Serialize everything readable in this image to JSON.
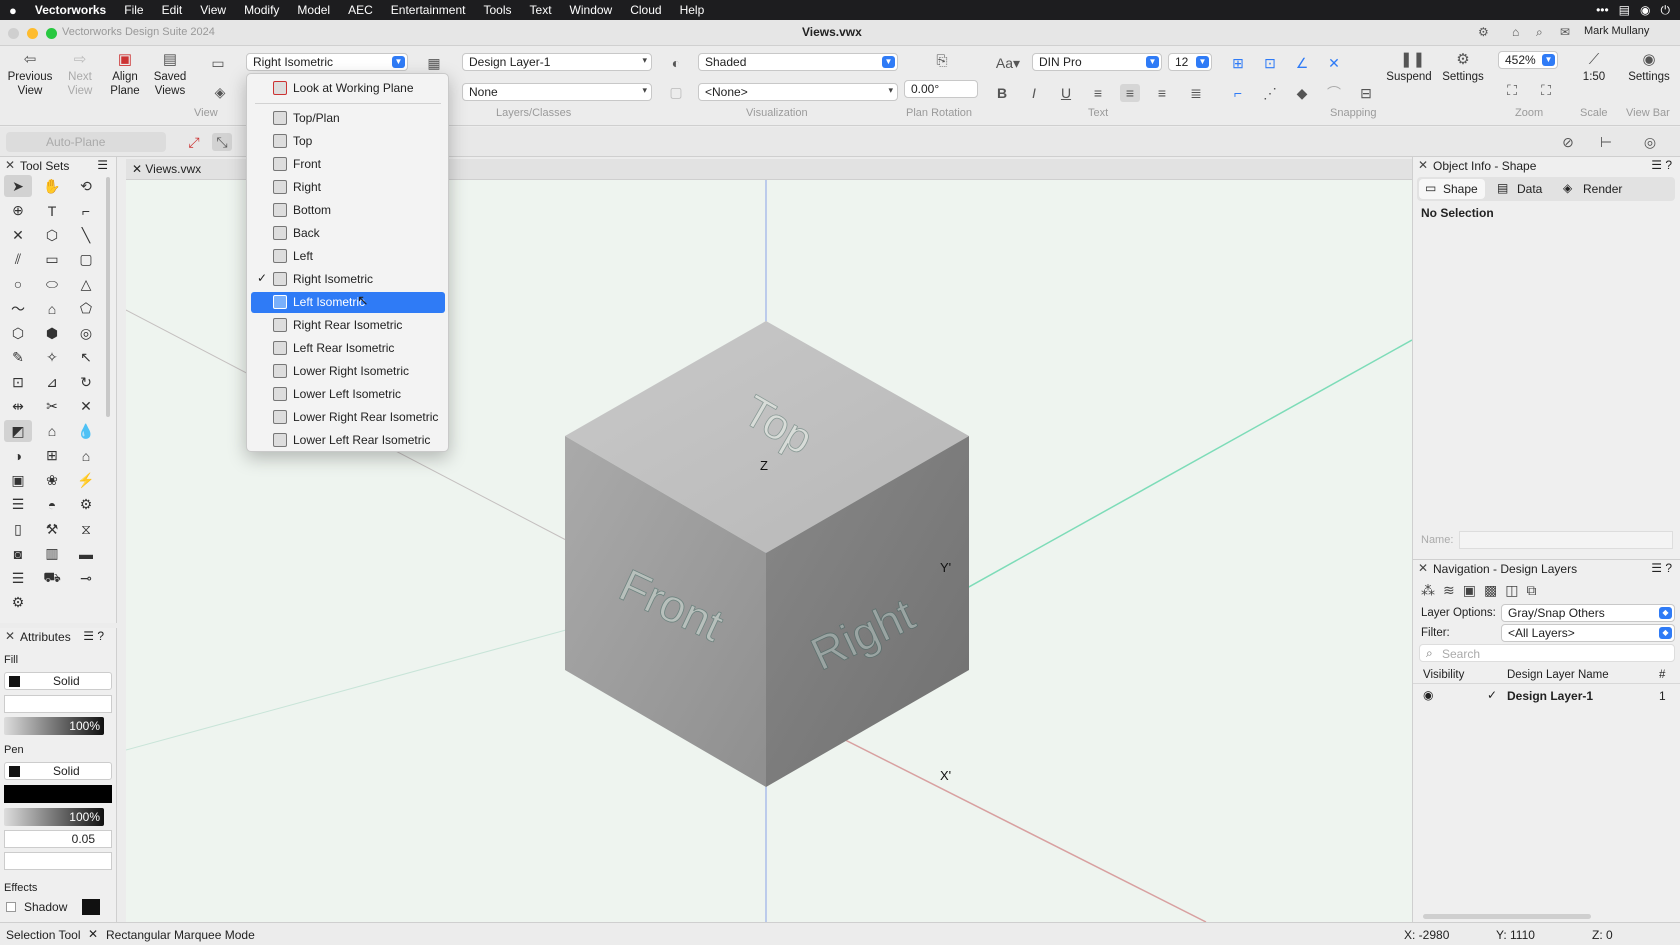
{
  "menubar": {
    "app": "Vectorworks",
    "items": [
      "File",
      "Edit",
      "View",
      "Modify",
      "Model",
      "AEC",
      "Entertainment",
      "Tools",
      "Text",
      "Window",
      "Cloud",
      "Help"
    ]
  },
  "titlebar": {
    "app_title": "Vectorworks Design Suite 2024",
    "doc_title": "Views.vwx",
    "user": "Mark Mullany"
  },
  "toolbar": {
    "previous_view": "Previous View",
    "next_view": "Next View",
    "align_plane": "Align Plane",
    "saved_views": "Saved Views",
    "view_combo": "Right Isometric",
    "layer_combo": "Design Layer-1",
    "class_combo": "None",
    "render_combo": "Shaded",
    "lighting_combo": "<None>",
    "rotation_value": "0.00°",
    "font_combo": "DIN Pro",
    "font_size": "12",
    "zoom_value": "452%",
    "suspend": "Suspend",
    "settings": "Settings",
    "scale_value": "1:50",
    "viewbar_settings": "Settings",
    "groups": {
      "view": "View",
      "layers": "Layers/Classes",
      "visualization": "Visualization",
      "plan_rotation": "Plan Rotation",
      "text": "Text",
      "snapping": "Snapping",
      "zoom": "Zoom",
      "scale": "Scale",
      "view_bar": "View Bar"
    },
    "auto_plane": "Auto-Plane"
  },
  "toolsets": {
    "title": "Tool Sets"
  },
  "view_tab": "Views.vwx",
  "attributes": {
    "title": "Attributes",
    "fill_label": "Fill",
    "fill_style": "Solid",
    "fill_opacity": "100%",
    "pen_label": "Pen",
    "pen_style": "Solid",
    "pen_opacity": "100%",
    "line_weight": "0.05",
    "effects_label": "Effects",
    "shadow_label": "Shadow"
  },
  "view_menu": {
    "items": [
      {
        "label": "Look at Working Plane",
        "checked": false,
        "highlighted": false
      },
      {
        "label": "Top/Plan",
        "checked": false,
        "highlighted": false
      },
      {
        "label": "Top",
        "checked": false,
        "highlighted": false
      },
      {
        "label": "Front",
        "checked": false,
        "highlighted": false
      },
      {
        "label": "Right",
        "checked": false,
        "highlighted": false
      },
      {
        "label": "Bottom",
        "checked": false,
        "highlighted": false
      },
      {
        "label": "Back",
        "checked": false,
        "highlighted": false
      },
      {
        "label": "Left",
        "checked": false,
        "highlighted": false
      },
      {
        "label": "Right Isometric",
        "checked": true,
        "highlighted": false
      },
      {
        "label": "Left Isometric",
        "checked": false,
        "highlighted": true
      },
      {
        "label": "Right Rear Isometric",
        "checked": false,
        "highlighted": false
      },
      {
        "label": "Left Rear Isometric",
        "checked": false,
        "highlighted": false
      },
      {
        "label": "Lower Right Isometric",
        "checked": false,
        "highlighted": false
      },
      {
        "label": "Lower Left Isometric",
        "checked": false,
        "highlighted": false
      },
      {
        "label": "Lower Right Rear Isometric",
        "checked": false,
        "highlighted": false
      },
      {
        "label": "Lower Left Rear Isometric",
        "checked": false,
        "highlighted": false
      }
    ]
  },
  "cube": {
    "top_label": "Top",
    "front_label": "Front",
    "right_label": "Right",
    "axis_z": "Z",
    "axis_y": "Y'",
    "axis_x": "X'"
  },
  "object_info": {
    "title": "Object Info - Shape",
    "tab_shape": "Shape",
    "tab_data": "Data",
    "tab_render": "Render",
    "selection": "No Selection",
    "name_label": "Name:"
  },
  "navigation": {
    "title": "Navigation - Design Layers",
    "layer_options_label": "Layer Options:",
    "layer_options_value": "Gray/Snap Others",
    "filter_label": "Filter:",
    "filter_value": "<All Layers>",
    "search_placeholder": "Search",
    "col_visibility": "Visibility",
    "col_name": "Design Layer Name",
    "col_num": "#",
    "rows": [
      {
        "name": "Design Layer-1",
        "num": "1"
      }
    ]
  },
  "status": {
    "tool": "Selection Tool",
    "mode": "Rectangular Marquee Mode",
    "x": "X: -2980",
    "y": "Y: 1110",
    "z": "Z: 0"
  },
  "colors": {
    "highlight": "#2f7bf6",
    "canvas": "#eef4ef",
    "menubar": "#1d1d1f"
  }
}
